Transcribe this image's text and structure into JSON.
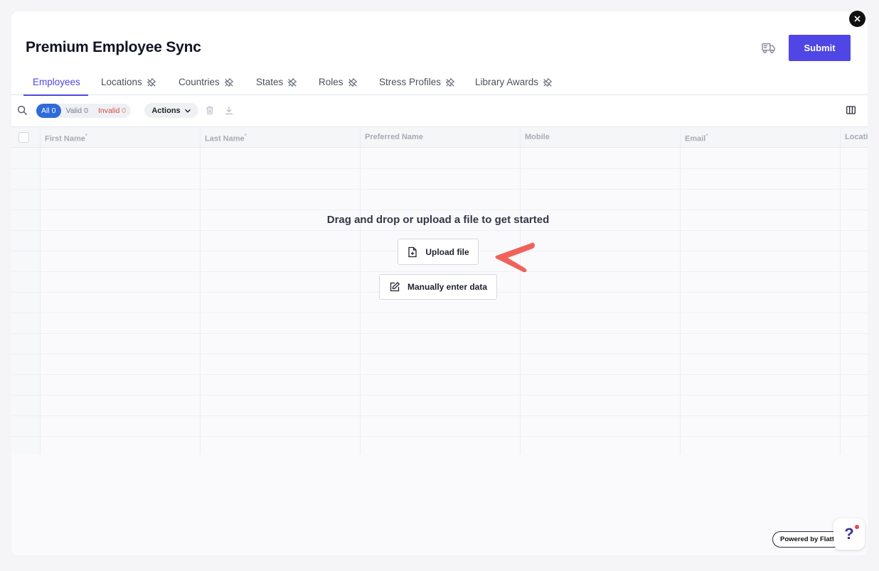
{
  "window": {
    "title": "Premium Employee Sync"
  },
  "header": {
    "submit_label": "Submit",
    "truck_icon": "truck-icon",
    "close_icon": "close-icon"
  },
  "tabs": [
    {
      "label": "Employees",
      "active": true
    },
    {
      "label": "Locations",
      "pinned": true
    },
    {
      "label": "Countries",
      "pinned": true
    },
    {
      "label": "States",
      "pinned": true
    },
    {
      "label": "Roles",
      "pinned": true
    },
    {
      "label": "Stress Profiles",
      "pinned": true
    },
    {
      "label": "Library Awards",
      "pinned": true
    }
  ],
  "toolbar": {
    "filters": [
      {
        "label": "All",
        "count": "0"
      },
      {
        "label": "Valid",
        "count": "0"
      },
      {
        "label": "Invalid",
        "count": "0"
      }
    ],
    "actions_label": "Actions"
  },
  "grid": {
    "columns": [
      {
        "label": "First Name",
        "required": "*"
      },
      {
        "label": "Last Name",
        "required": "*"
      },
      {
        "label": "Preferred Name",
        "required": ""
      },
      {
        "label": "Mobile",
        "required": ""
      },
      {
        "label": "Email",
        "required": "*"
      },
      {
        "label": "Locati",
        "required": ""
      }
    ]
  },
  "empty_state": {
    "message": "Drag and drop or upload a file to get started",
    "upload_label": "Upload file",
    "manual_label": "Manually enter data"
  },
  "footer": {
    "powered_by": "Powered by Flatfile",
    "help": "?"
  },
  "colors": {
    "accent": "#4f46e5",
    "all_pill": "#2f6bd8",
    "invalid": "#d9483b",
    "arrow": "#f0625a"
  }
}
